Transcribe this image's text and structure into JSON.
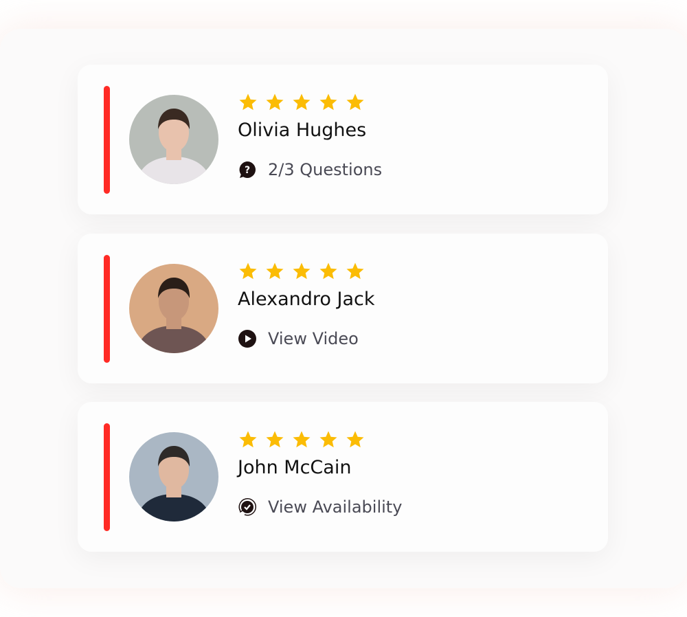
{
  "colors": {
    "accent": "#ff2b25",
    "star": "#fbbc05",
    "icon": "#1e1111"
  },
  "cards": [
    {
      "name": "Olivia Hughes",
      "rating": 5,
      "action": "2/3 Questions",
      "icon": "question-bubble-icon",
      "avatar_bg": "#b8bdb8",
      "shirt": "#e8e4e8",
      "hair": "#3a2a22",
      "skin": "#e8c2ad"
    },
    {
      "name": "Alexandro Jack",
      "rating": 5,
      "action": "View Video",
      "icon": "play-icon",
      "avatar_bg": "#d9a983",
      "shirt": "#6e5553",
      "hair": "#2a1e18",
      "skin": "#c7977a"
    },
    {
      "name": "John McCain",
      "rating": 5,
      "action": "View Availability",
      "icon": "check-circle-icon",
      "avatar_bg": "#aab7c4",
      "shirt": "#1f2a3a",
      "hair": "#2e2a28",
      "skin": "#e0b8a0"
    }
  ]
}
